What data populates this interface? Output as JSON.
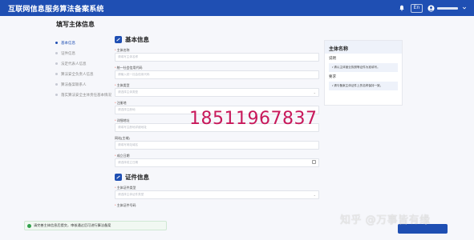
{
  "app": {
    "title": "互联网信息服务算法备案系统"
  },
  "topbar": {
    "lang_label": "En"
  },
  "page": {
    "title": "填写主体信息"
  },
  "sidebar": {
    "items": [
      {
        "label": "基本信息",
        "active": true
      },
      {
        "label": "证件信息",
        "active": false
      },
      {
        "label": "法定代表人信息",
        "active": false
      },
      {
        "label": "算法安全负责人信息",
        "active": false
      },
      {
        "label": "算法备案联系人",
        "active": false
      },
      {
        "label": "落实算法安全主体责任基本情况",
        "active": false
      }
    ]
  },
  "form": {
    "section_basic": {
      "title": "基本信息"
    },
    "fields": [
      {
        "label": "主体名称",
        "placeholder": "请填写主体名称",
        "type": "text"
      },
      {
        "label": "统一社会信用代码",
        "placeholder": "请输入统一社会信用代码",
        "type": "text"
      },
      {
        "label": "主体类型",
        "placeholder": "请选择主体类型",
        "type": "select"
      },
      {
        "label": "注册地",
        "placeholder": "请选择注册地",
        "type": "select"
      },
      {
        "label": "详细地址",
        "placeholder": "请填写注册地详细地址",
        "type": "text"
      },
      {
        "label": "网站(主域)",
        "placeholder": "请填写网站域名",
        "type": "text"
      },
      {
        "label": "成立日期",
        "placeholder": "请选择成立日期",
        "type": "date"
      }
    ],
    "section_cert": {
      "title": "证件信息"
    },
    "cert_fields": [
      {
        "label": "主体证件类型",
        "placeholder": "请选择主体证件类型",
        "type": "select"
      },
      {
        "label": "主体证件号码",
        "placeholder": "",
        "type": "text"
      }
    ]
  },
  "panel": {
    "title": "主体名称",
    "desc_label": "说明",
    "desc_text": "• 请以主体营业执照等证件为准填写。",
    "req_label": "要求",
    "req_text": "• 请与备案主体证件上的名称保持一致。"
  },
  "overlay": {
    "phone": "18511967837"
  },
  "toast": {
    "text": "请完善主体信息后提交，审核通过后可进行算法备案"
  },
  "watermark": {
    "text": "知乎 @万事皆有缘"
  },
  "colors": {
    "brand": "#1f4fb3",
    "toast_green": "#31a24c",
    "overlay_pink": "#c8185a"
  }
}
